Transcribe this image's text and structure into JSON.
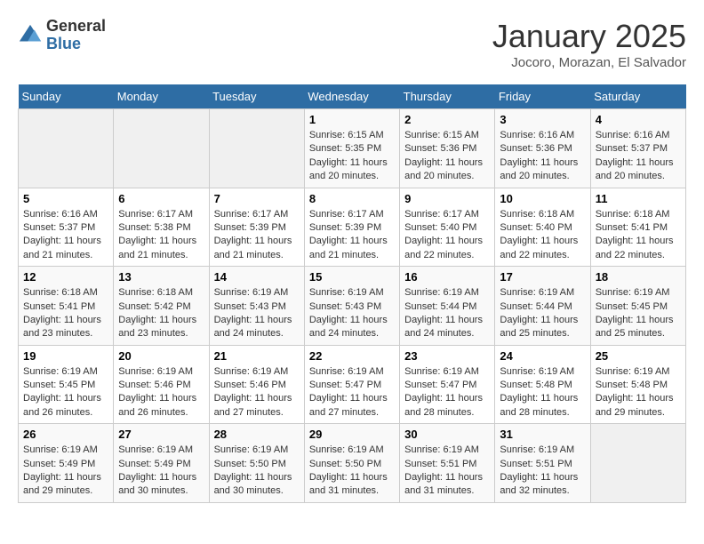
{
  "logo": {
    "general": "General",
    "blue": "Blue"
  },
  "header": {
    "title": "January 2025",
    "location": "Jocoro, Morazan, El Salvador"
  },
  "weekdays": [
    "Sunday",
    "Monday",
    "Tuesday",
    "Wednesday",
    "Thursday",
    "Friday",
    "Saturday"
  ],
  "weeks": [
    [
      {
        "day": "",
        "info": ""
      },
      {
        "day": "",
        "info": ""
      },
      {
        "day": "",
        "info": ""
      },
      {
        "day": "1",
        "info": "Sunrise: 6:15 AM\nSunset: 5:35 PM\nDaylight: 11 hours\nand 20 minutes."
      },
      {
        "day": "2",
        "info": "Sunrise: 6:15 AM\nSunset: 5:36 PM\nDaylight: 11 hours\nand 20 minutes."
      },
      {
        "day": "3",
        "info": "Sunrise: 6:16 AM\nSunset: 5:36 PM\nDaylight: 11 hours\nand 20 minutes."
      },
      {
        "day": "4",
        "info": "Sunrise: 6:16 AM\nSunset: 5:37 PM\nDaylight: 11 hours\nand 20 minutes."
      }
    ],
    [
      {
        "day": "5",
        "info": "Sunrise: 6:16 AM\nSunset: 5:37 PM\nDaylight: 11 hours\nand 21 minutes."
      },
      {
        "day": "6",
        "info": "Sunrise: 6:17 AM\nSunset: 5:38 PM\nDaylight: 11 hours\nand 21 minutes."
      },
      {
        "day": "7",
        "info": "Sunrise: 6:17 AM\nSunset: 5:39 PM\nDaylight: 11 hours\nand 21 minutes."
      },
      {
        "day": "8",
        "info": "Sunrise: 6:17 AM\nSunset: 5:39 PM\nDaylight: 11 hours\nand 21 minutes."
      },
      {
        "day": "9",
        "info": "Sunrise: 6:17 AM\nSunset: 5:40 PM\nDaylight: 11 hours\nand 22 minutes."
      },
      {
        "day": "10",
        "info": "Sunrise: 6:18 AM\nSunset: 5:40 PM\nDaylight: 11 hours\nand 22 minutes."
      },
      {
        "day": "11",
        "info": "Sunrise: 6:18 AM\nSunset: 5:41 PM\nDaylight: 11 hours\nand 22 minutes."
      }
    ],
    [
      {
        "day": "12",
        "info": "Sunrise: 6:18 AM\nSunset: 5:41 PM\nDaylight: 11 hours\nand 23 minutes."
      },
      {
        "day": "13",
        "info": "Sunrise: 6:18 AM\nSunset: 5:42 PM\nDaylight: 11 hours\nand 23 minutes."
      },
      {
        "day": "14",
        "info": "Sunrise: 6:19 AM\nSunset: 5:43 PM\nDaylight: 11 hours\nand 24 minutes."
      },
      {
        "day": "15",
        "info": "Sunrise: 6:19 AM\nSunset: 5:43 PM\nDaylight: 11 hours\nand 24 minutes."
      },
      {
        "day": "16",
        "info": "Sunrise: 6:19 AM\nSunset: 5:44 PM\nDaylight: 11 hours\nand 24 minutes."
      },
      {
        "day": "17",
        "info": "Sunrise: 6:19 AM\nSunset: 5:44 PM\nDaylight: 11 hours\nand 25 minutes."
      },
      {
        "day": "18",
        "info": "Sunrise: 6:19 AM\nSunset: 5:45 PM\nDaylight: 11 hours\nand 25 minutes."
      }
    ],
    [
      {
        "day": "19",
        "info": "Sunrise: 6:19 AM\nSunset: 5:45 PM\nDaylight: 11 hours\nand 26 minutes."
      },
      {
        "day": "20",
        "info": "Sunrise: 6:19 AM\nSunset: 5:46 PM\nDaylight: 11 hours\nand 26 minutes."
      },
      {
        "day": "21",
        "info": "Sunrise: 6:19 AM\nSunset: 5:46 PM\nDaylight: 11 hours\nand 27 minutes."
      },
      {
        "day": "22",
        "info": "Sunrise: 6:19 AM\nSunset: 5:47 PM\nDaylight: 11 hours\nand 27 minutes."
      },
      {
        "day": "23",
        "info": "Sunrise: 6:19 AM\nSunset: 5:47 PM\nDaylight: 11 hours\nand 28 minutes."
      },
      {
        "day": "24",
        "info": "Sunrise: 6:19 AM\nSunset: 5:48 PM\nDaylight: 11 hours\nand 28 minutes."
      },
      {
        "day": "25",
        "info": "Sunrise: 6:19 AM\nSunset: 5:48 PM\nDaylight: 11 hours\nand 29 minutes."
      }
    ],
    [
      {
        "day": "26",
        "info": "Sunrise: 6:19 AM\nSunset: 5:49 PM\nDaylight: 11 hours\nand 29 minutes."
      },
      {
        "day": "27",
        "info": "Sunrise: 6:19 AM\nSunset: 5:49 PM\nDaylight: 11 hours\nand 30 minutes."
      },
      {
        "day": "28",
        "info": "Sunrise: 6:19 AM\nSunset: 5:50 PM\nDaylight: 11 hours\nand 30 minutes."
      },
      {
        "day": "29",
        "info": "Sunrise: 6:19 AM\nSunset: 5:50 PM\nDaylight: 11 hours\nand 31 minutes."
      },
      {
        "day": "30",
        "info": "Sunrise: 6:19 AM\nSunset: 5:51 PM\nDaylight: 11 hours\nand 31 minutes."
      },
      {
        "day": "31",
        "info": "Sunrise: 6:19 AM\nSunset: 5:51 PM\nDaylight: 11 hours\nand 32 minutes."
      },
      {
        "day": "",
        "info": ""
      }
    ]
  ]
}
